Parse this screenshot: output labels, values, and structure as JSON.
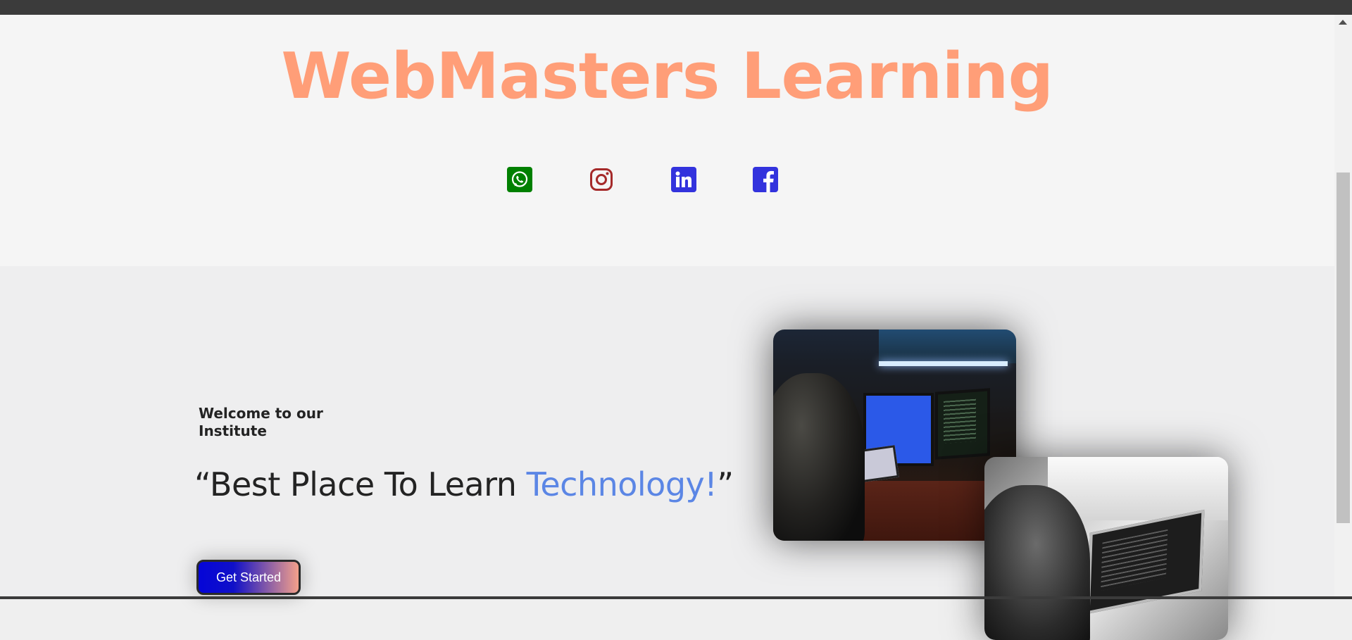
{
  "header": {
    "title": "WebMasters Learning",
    "social_links": [
      {
        "name": "whatsapp",
        "icon": "whatsapp-icon",
        "color": "#008000"
      },
      {
        "name": "instagram",
        "icon": "instagram-icon",
        "color": "#a52a2a"
      },
      {
        "name": "linkedin",
        "icon": "linkedin-icon",
        "color": "#3333dd"
      },
      {
        "name": "facebook",
        "icon": "facebook-icon",
        "color": "#3333dd"
      }
    ]
  },
  "hero": {
    "welcome": "Welcome to our Institute",
    "tagline_open_quote": "“",
    "tagline_main": "Best Place To Learn ",
    "tagline_highlight": "Technology!",
    "tagline_close_quote": "”",
    "cta_label": "Get Started"
  },
  "theme": {
    "title_color": "#ff9e78",
    "highlight_color": "#5b86e5",
    "text_color": "#232323"
  }
}
